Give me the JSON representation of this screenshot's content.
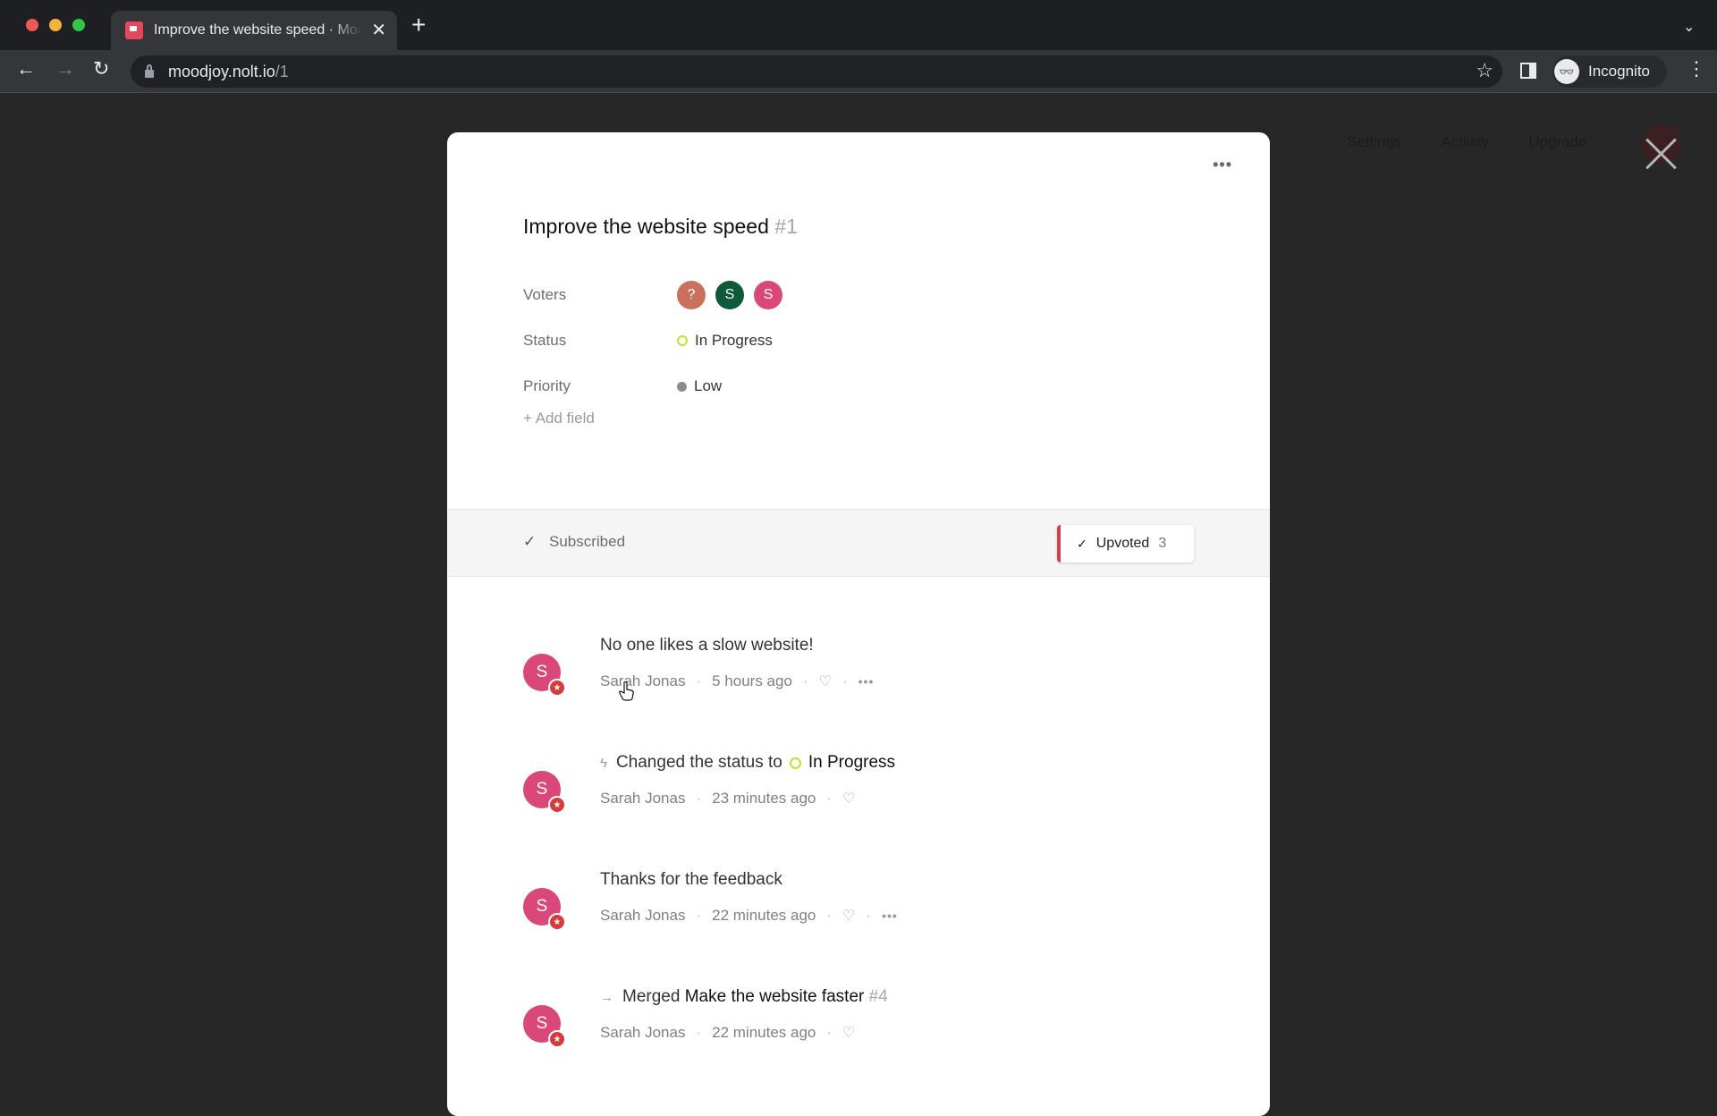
{
  "browser": {
    "tab_title": "Improve the website speed · Moodjoy",
    "url_host": "moodjoy.nolt.io",
    "url_path": "/1",
    "profile_label": "Incognito"
  },
  "background_nav": {
    "items": [
      "Settings",
      "Activity",
      "Upgrade"
    ]
  },
  "post": {
    "title": "Improve the website speed",
    "number": "#1",
    "more_label": "•••",
    "fields": {
      "voters_label": "Voters",
      "voters": [
        {
          "initial": "?",
          "color": "#c9715f"
        },
        {
          "initial": "S",
          "color": "#0f5a3a"
        },
        {
          "initial": "S",
          "color": "#d94878"
        }
      ],
      "status_label": "Status",
      "status_value": "In Progress",
      "status_color": "#c5e02f",
      "priority_label": "Priority",
      "priority_value": "Low",
      "priority_color": "#8c8c8c"
    },
    "add_field_label": "+ Add field"
  },
  "actions": {
    "subscribed_check": "✓",
    "subscribed_label": "Subscribed",
    "upvote_check": "✓",
    "upvote_label": "Upvoted",
    "upvote_count": "3"
  },
  "activity": [
    {
      "type": "comment",
      "avatar": "S",
      "text": "No one likes a slow website!",
      "author": "Sarah Jonas",
      "time": "5 hours ago",
      "has_more": true
    },
    {
      "type": "status_change",
      "avatar": "S",
      "icon": "lightning-icon",
      "prefix": "Changed the status to",
      "status": "In Progress",
      "author": "Sarah Jonas",
      "time": "23 minutes ago",
      "has_more": false
    },
    {
      "type": "comment",
      "avatar": "S",
      "text": "Thanks for the feedback",
      "author": "Sarah Jonas",
      "time": "22 minutes ago",
      "has_more": true
    },
    {
      "type": "merge",
      "avatar": "S",
      "icon": "arrow-right-icon",
      "prefix": "Merged",
      "target": "Make the website faster",
      "target_number": "#4",
      "author": "Sarah Jonas",
      "time": "22 minutes ago",
      "has_more": false
    }
  ]
}
